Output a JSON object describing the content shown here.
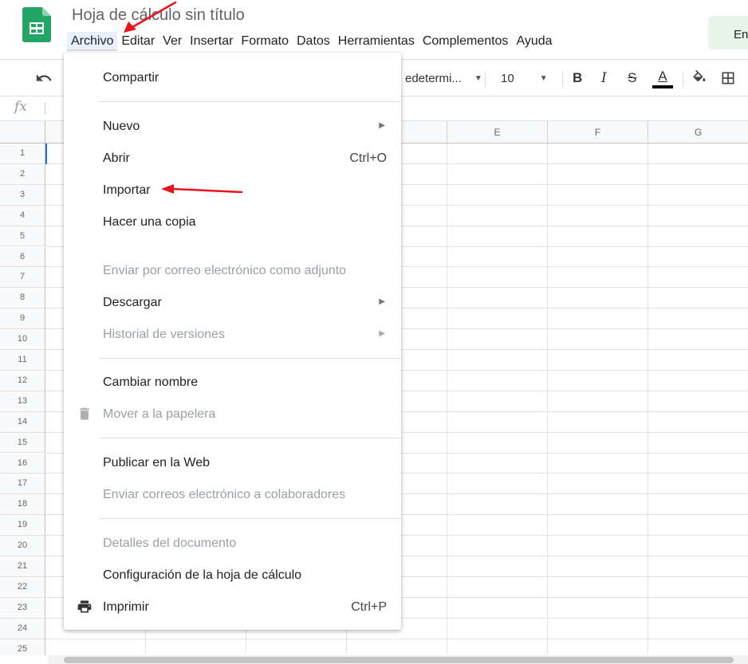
{
  "header": {
    "title": "Hoja de cálculo sin título",
    "share_label": "En"
  },
  "menubar": [
    {
      "label": "Archivo",
      "active": true
    },
    {
      "label": "Editar"
    },
    {
      "label": "Ver"
    },
    {
      "label": "Insertar"
    },
    {
      "label": "Formato"
    },
    {
      "label": "Datos"
    },
    {
      "label": "Herramientas"
    },
    {
      "label": "Complementos"
    },
    {
      "label": "Ayuda"
    }
  ],
  "toolbar": {
    "font_name": "edetermi...",
    "font_size": "10",
    "bold": "B",
    "italic": "I",
    "strike": "S",
    "text_color": "A"
  },
  "formula_bar": {
    "fx": "fx"
  },
  "grid": {
    "columns": [
      "E",
      "F",
      "G"
    ],
    "rows": [
      "1",
      "2",
      "3",
      "4",
      "5",
      "6",
      "7",
      "8",
      "9",
      "10",
      "11",
      "12",
      "13",
      "14",
      "15",
      "16",
      "17",
      "18",
      "19",
      "20",
      "21",
      "22",
      "23",
      "24",
      "25"
    ]
  },
  "file_menu": {
    "items": [
      {
        "label": "Compartir"
      },
      {
        "label": "Nuevo",
        "submenu": true
      },
      {
        "label": "Abrir",
        "shortcut": "Ctrl+O"
      },
      {
        "label": "Importar"
      },
      {
        "label": "Hacer una copia"
      },
      {
        "label": "Enviar por correo electrónico como adjunto",
        "disabled": true
      },
      {
        "label": "Descargar",
        "submenu": true
      },
      {
        "label": "Historial de versiones",
        "submenu": true,
        "disabled": true
      },
      {
        "label": "Cambiar nombre"
      },
      {
        "label": "Mover a la papelera",
        "disabled": true,
        "icon": "trash-icon"
      },
      {
        "label": "Publicar en la Web"
      },
      {
        "label": "Enviar correos electrónico a colaboradores",
        "disabled": true
      },
      {
        "label": "Detalles del documento",
        "disabled": true
      },
      {
        "label": "Configuración de la hoja de cálculo"
      },
      {
        "label": "Imprimir",
        "shortcut": "Ctrl+P",
        "icon": "printer-icon"
      }
    ]
  },
  "colors": {
    "sheets_green": "#23a566",
    "annotation_red": "#e8141c",
    "disabled_text": "#9aa0a6",
    "active_menu_bg": "#e8f0fe"
  }
}
